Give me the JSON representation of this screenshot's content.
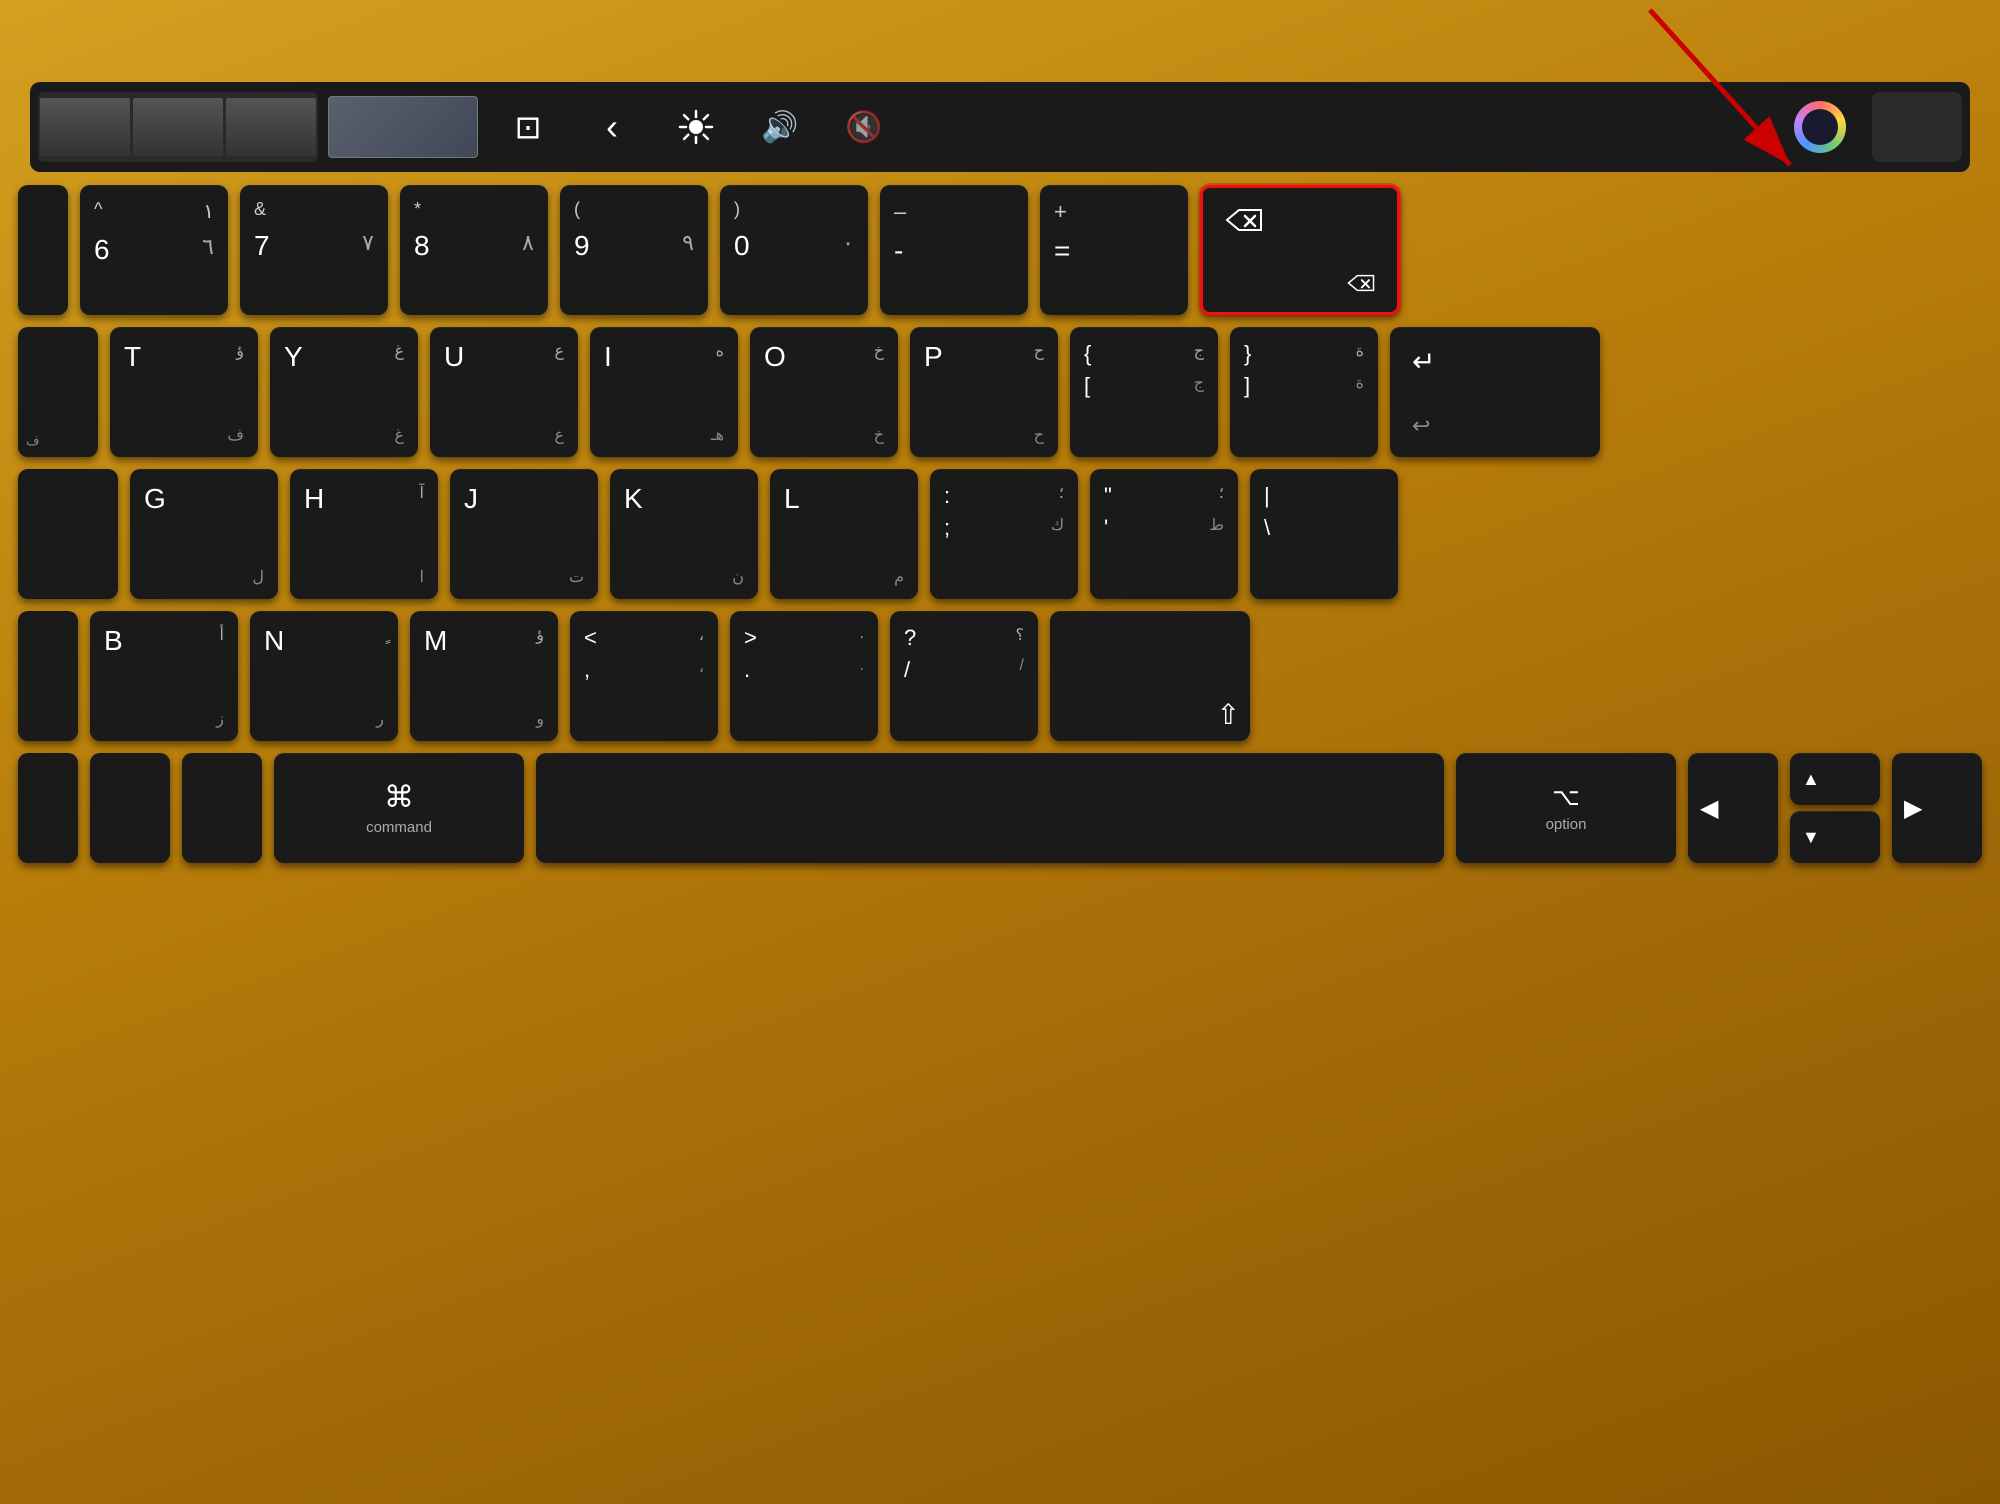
{
  "keyboard": {
    "background_color": "#c8920a",
    "touch_bar": {
      "buttons": [
        {
          "id": "thumbnails",
          "icon": "⊞"
        },
        {
          "id": "tab-overview",
          "icon": "⊡"
        },
        {
          "id": "back",
          "icon": "‹"
        },
        {
          "id": "brightness",
          "icon": "☀"
        },
        {
          "id": "volume",
          "icon": "🔊"
        },
        {
          "id": "volume-muted",
          "icon": "🔇"
        },
        {
          "id": "siri",
          "icon": "siri"
        },
        {
          "id": "power",
          "icon": ""
        }
      ]
    },
    "annotation": {
      "arrow_color": "#cc0000",
      "highlighted_key": "backspace",
      "label": "option"
    },
    "rows": {
      "number_row": [
        {
          "top_left": "^",
          "top_right": "",
          "bottom_left": "٦",
          "bottom_right": "6",
          "arabic": ""
        },
        {
          "top_left": "&",
          "top_right": "",
          "bottom_left": "٧",
          "bottom_right": "7",
          "arabic": ""
        },
        {
          "top_left": "*",
          "top_right": "",
          "bottom_left": "٨",
          "bottom_right": "8",
          "arabic": ""
        },
        {
          "top_left": "(",
          "top_right": "",
          "bottom_left": "٩",
          "bottom_right": "9",
          "arabic": ""
        },
        {
          "top_left": ")",
          "top_right": "",
          "bottom_left": "٠",
          "bottom_right": "0",
          "arabic": ""
        },
        {
          "top_left": "–",
          "top_right": "",
          "bottom_left": "-",
          "bottom_right": "",
          "arabic": ""
        },
        {
          "top_left": "+",
          "top_right": "",
          "bottom_left": "=",
          "bottom_right": "",
          "arabic": ""
        },
        {
          "top_left": "⌫",
          "top_right": "",
          "bottom_left": "",
          "bottom_right": "",
          "arabic": "",
          "special": "backspace"
        }
      ],
      "qwerty_row": [
        {
          "main": "T",
          "arabic_top": "ؤ",
          "arabic_bot": "ف"
        },
        {
          "main": "Y",
          "arabic_top": "غ",
          "arabic_bot": "غ"
        },
        {
          "main": "U",
          "arabic_top": "ع",
          "arabic_bot": "ع"
        },
        {
          "main": "I",
          "arabic_top": "ه",
          "arabic_bot": "هـ"
        },
        {
          "main": "O",
          "arabic_top": "خ",
          "arabic_bot": "خ"
        },
        {
          "main": "P",
          "arabic_top": "ح",
          "arabic_bot": "ح"
        },
        {
          "main": "{",
          "arabic_top": "ج",
          "arabic_bot": "ج"
        },
        {
          "main": "}",
          "arabic_top": "ة",
          "arabic_bot": "ة"
        },
        {
          "main": "⏎",
          "special": "return"
        }
      ],
      "home_row": [
        {
          "main": "G",
          "arabic_bot": "ل"
        },
        {
          "main": "H",
          "arabic_top": "آ",
          "arabic_bot": "ا"
        },
        {
          "main": "J",
          "arabic_bot": "ت"
        },
        {
          "main": "K",
          "arabic_bot": "ن"
        },
        {
          "main": "L",
          "arabic_bot": "م"
        },
        {
          "main": ":",
          "arabic_bot": "ك"
        },
        {
          "main": "\"",
          "arabic_bot": "ط"
        },
        {
          "main": "|",
          "arabic_bot": "\\"
        }
      ],
      "shift_row": [
        {
          "main": "B",
          "arabic_top": "أ",
          "arabic_bot": "ز"
        },
        {
          "main": "N",
          "arabic_top": "ٍ",
          "arabic_bot": "ر"
        },
        {
          "main": "M",
          "arabic_top": "ؤ",
          "arabic_bot": "و"
        },
        {
          "main": "<",
          "arabic_top": "،",
          "arabic_bot": ","
        },
        {
          "main": ">",
          "arabic_top": ".",
          "arabic_bot": "."
        },
        {
          "main": "?",
          "arabic_top": "؟",
          "arabic_bot": "/"
        }
      ],
      "bottom_row": [
        {
          "id": "command",
          "symbol": "⌘",
          "label": "command"
        },
        {
          "id": "option",
          "symbol": "⌥",
          "label": "option"
        },
        {
          "id": "arrow-left",
          "symbol": "◀"
        },
        {
          "id": "arrow-up",
          "symbol": "▲"
        },
        {
          "id": "arrow-down",
          "symbol": "▼"
        },
        {
          "id": "arrow-right",
          "symbol": "▶"
        }
      ]
    }
  }
}
